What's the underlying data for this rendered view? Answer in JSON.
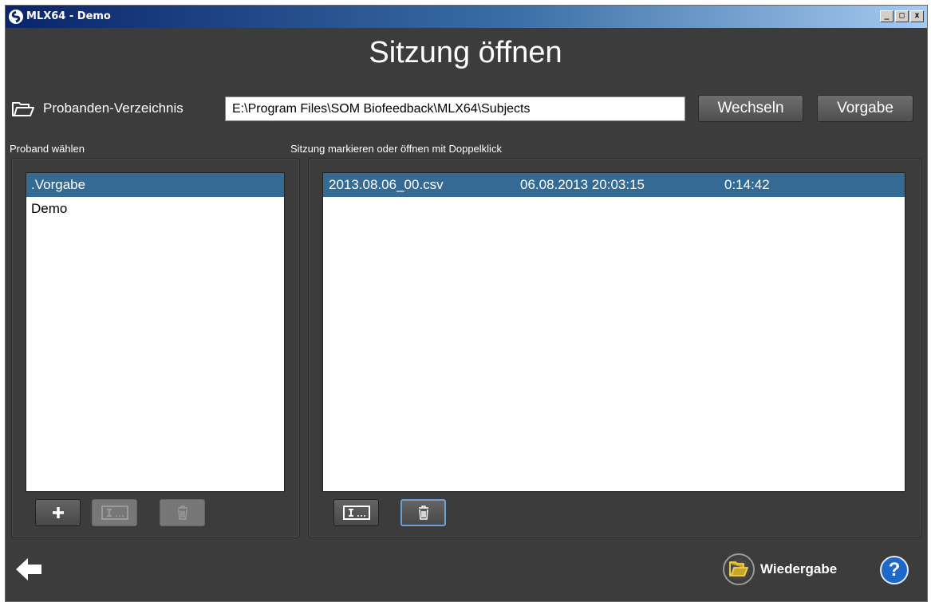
{
  "window": {
    "title": "MLX64 - Demo",
    "controls": {
      "minimize": "_",
      "maximize": "□",
      "close": "x"
    }
  },
  "page_title": "Sitzung öffnen",
  "directory": {
    "label": "Probanden-Verzeichnis",
    "path": "E:\\Program Files\\SOM Biofeedback\\MLX64\\Subjects",
    "change_button": "Wechseln",
    "default_button": "Vorgabe"
  },
  "subjects": {
    "section_label": "Proband wählen",
    "items": [
      {
        "name": ".Vorgabe",
        "selected": true
      },
      {
        "name": "Demo",
        "selected": false
      }
    ],
    "toolbar": {
      "add_icon": "plus-icon",
      "rename_icon": "rename-icon",
      "delete_icon": "trash-icon"
    }
  },
  "sessions": {
    "section_label": "Sitzung markieren oder öffnen mit Doppelklick",
    "items": [
      {
        "file": "2013.08.06_00.csv",
        "date": "06.08.2013 20:03:15",
        "duration": "0:14:42",
        "selected": true
      }
    ],
    "toolbar": {
      "rename_icon": "rename-icon",
      "delete_icon": "trash-icon"
    }
  },
  "footer": {
    "back_icon": "arrow-left-icon",
    "playback_label": "Wiedergabe",
    "playback_icon": "folder-icon",
    "help_label": "?"
  },
  "colors": {
    "background": "#3c3c3c",
    "selection": "#356a92",
    "help": "#1f68c9"
  }
}
